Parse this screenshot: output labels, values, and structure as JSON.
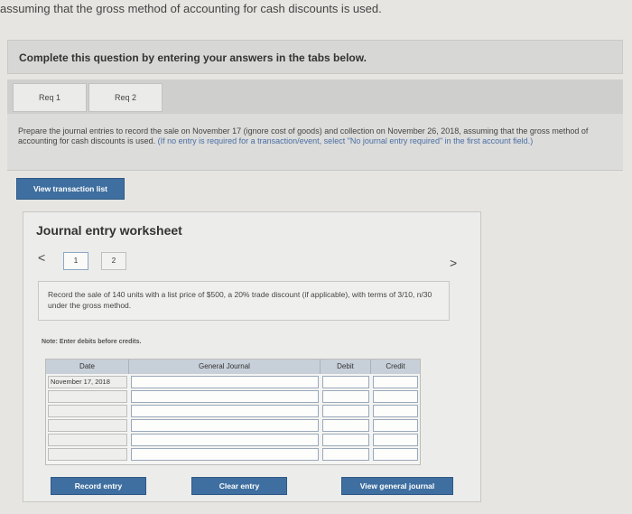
{
  "header": {
    "context_text": "assuming that the gross method of accounting for cash discounts is used."
  },
  "instructions": {
    "text": "Complete this question by entering your answers in the tabs below."
  },
  "tabs": [
    {
      "label": "Req 1"
    },
    {
      "label": "Req 2"
    }
  ],
  "question": {
    "text": "Prepare the journal entries to record the sale on November 17 (ignore cost of goods) and collection on November 26, 2018, assuming that the gross method of accounting for cash discounts is used. ",
    "hint": "(If no entry is required for a transaction/event, select \"No journal entry required\" in the first account field.)"
  },
  "buttons": {
    "view_transaction_list": "View transaction list",
    "record_entry": "Record entry",
    "clear_entry": "Clear entry",
    "view_general_journal": "View general journal"
  },
  "worksheet": {
    "title": "Journal entry worksheet",
    "pages": [
      "1",
      "2"
    ],
    "prev_symbol": "<",
    "next_symbol": ">",
    "entry_description": "Record the sale of 140 units with a list price of $500, a 20% trade discount (if applicable), with terms of 3/10, n/30 under the gross method.",
    "note": "Note: Enter debits before credits."
  },
  "journal": {
    "columns": [
      "Date",
      "General Journal",
      "Debit",
      "Credit"
    ],
    "rows": [
      {
        "date": "November 17, 2018",
        "account": "",
        "debit": "",
        "credit": ""
      },
      {
        "date": "",
        "account": "",
        "debit": "",
        "credit": ""
      },
      {
        "date": "",
        "account": "",
        "debit": "",
        "credit": ""
      },
      {
        "date": "",
        "account": "",
        "debit": "",
        "credit": ""
      },
      {
        "date": "",
        "account": "",
        "debit": "",
        "credit": ""
      },
      {
        "date": "",
        "account": "",
        "debit": "",
        "credit": ""
      }
    ]
  }
}
